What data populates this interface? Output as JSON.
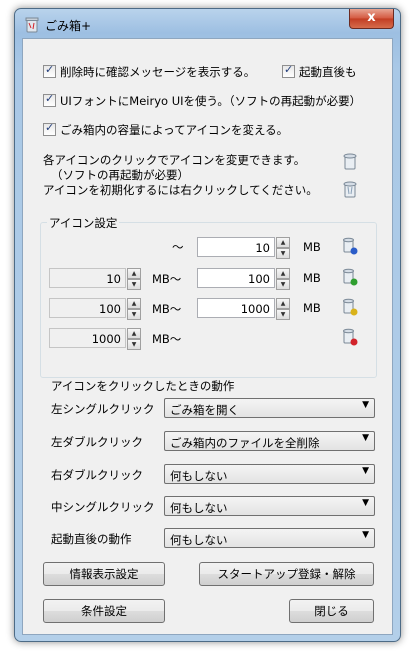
{
  "window": {
    "title": "ごみ箱+",
    "close_label": "x"
  },
  "options": {
    "confirm_delete": "削除時に確認メッセージを表示する。",
    "startup": "起動直後も",
    "meiryo": "UIフォントにMeiryo UIを使う。（ソフトの再起動が必要）",
    "icon_by_size": "ごみ箱内の容量によってアイコンを変える。"
  },
  "info": {
    "line1": "各アイコンのクリックでアイコンを変更できます。",
    "line2": "（ソフトの再起動が必要）",
    "line3": "アイコンを初期化するには右クリックしてください。"
  },
  "icon_settings": {
    "label": "アイコン設定",
    "tilde": "〜",
    "unit": "MB",
    "unit_tilde": "MB〜",
    "rows": [
      {
        "from": "",
        "to": "10"
      },
      {
        "from": "10",
        "to": "100"
      },
      {
        "from": "100",
        "to": "1000"
      },
      {
        "from": "1000",
        "to": ""
      }
    ]
  },
  "click_actions": {
    "label": "アイコンをクリックしたときの動作",
    "rows": [
      {
        "label": "左シングルクリック",
        "value": "ごみ箱を開く"
      },
      {
        "label": "左ダブルクリック",
        "value": "ごみ箱内のファイルを全削除"
      },
      {
        "label": "右ダブルクリック",
        "value": "何もしない"
      },
      {
        "label": "中シングルクリック",
        "value": "何もしない"
      },
      {
        "label": "起動直後の動作",
        "value": "何もしない"
      }
    ]
  },
  "buttons": {
    "info_display": "情報表示設定",
    "startup_register": "スタートアップ登録・解除",
    "condition": "条件設定",
    "close": "閉じる"
  },
  "colors": {
    "badge_blue": "#2a5cc8",
    "badge_green": "#2e9e2e",
    "badge_yellow": "#d9b21a",
    "badge_red": "#d2232a"
  }
}
